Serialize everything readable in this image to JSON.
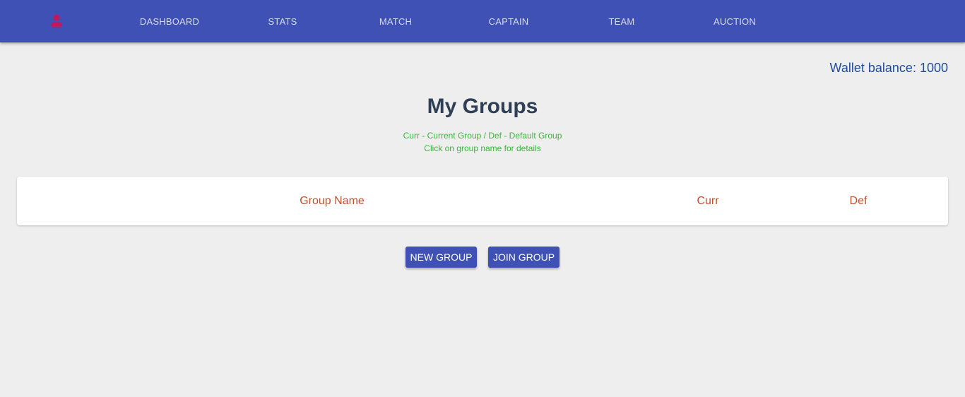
{
  "navbar": {
    "profile_icon": "person-icon",
    "profile_icon_color": "#c2185b",
    "background": "#3f51b5",
    "items": [
      {
        "label": "DASHBOARD"
      },
      {
        "label": "STATS"
      },
      {
        "label": "MATCH"
      },
      {
        "label": "CAPTAIN"
      },
      {
        "label": "TEAM"
      },
      {
        "label": "AUCTION"
      }
    ]
  },
  "wallet": {
    "text": "Wallet balance: 1000"
  },
  "page": {
    "title": "My Groups",
    "hint_line1": "Curr - Current Group / Def - Default Group",
    "hint_line2": "Click on group name for details"
  },
  "groups_table": {
    "columns": [
      "Group Name",
      "Curr",
      "Def"
    ],
    "rows": []
  },
  "actions": {
    "new_group_label": "NEW GROUP",
    "join_group_label": "JOIN GROUP"
  },
  "colors": {
    "primary": "#3f51b5",
    "header_text": "#c0502e",
    "hint_text": "#3cb43c",
    "wallet_text": "#1f4b99"
  }
}
